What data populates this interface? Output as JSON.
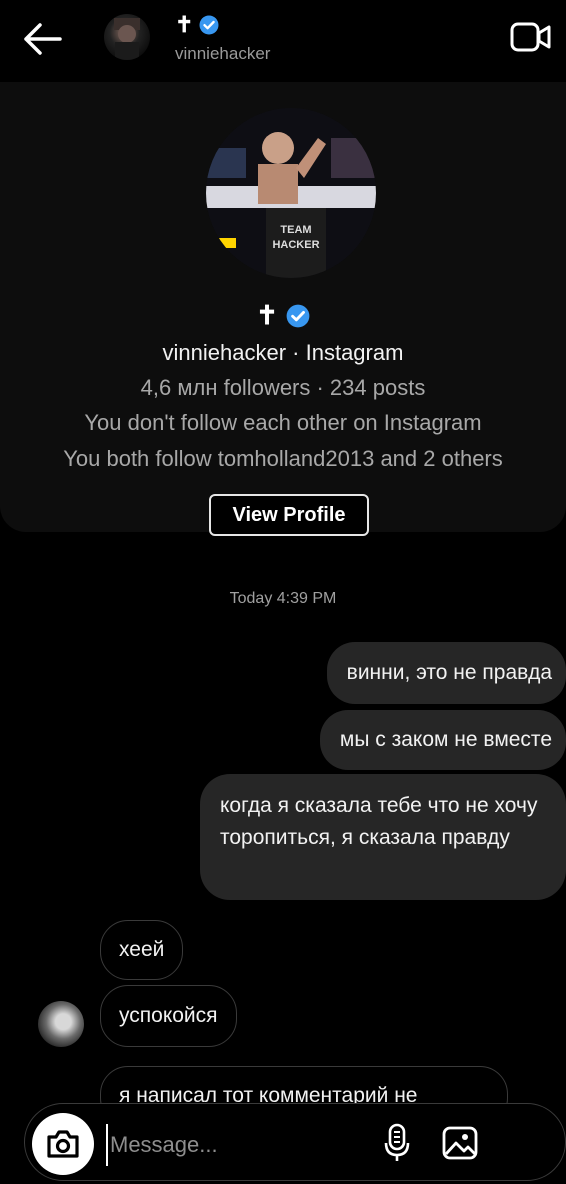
{
  "header": {
    "display_name": "✝",
    "username": "vinniehacker"
  },
  "profile": {
    "name_symbol": "✝",
    "title": "vinniehacker · Instagram",
    "stats": "4,6 млн followers · 234 posts",
    "follow_status": "You don't follow each other on Instagram",
    "mutual": "You both follow tomholland2013 and 2 others",
    "view_profile_label": "View Profile"
  },
  "timestamp": "Today 4:39 PM",
  "messages": {
    "outgoing": [
      "винни, это не правда",
      "мы с заком не вместе",
      "когда я сказала тебе что не хочу торопиться, я сказала правду"
    ],
    "incoming": [
      "хеей",
      "успокойся",
      "я написал тот комментарий не"
    ]
  },
  "composer": {
    "placeholder": "Message..."
  },
  "colors": {
    "background": "#000000",
    "bubble_outgoing": "#262626",
    "verified": "#3897f0"
  }
}
